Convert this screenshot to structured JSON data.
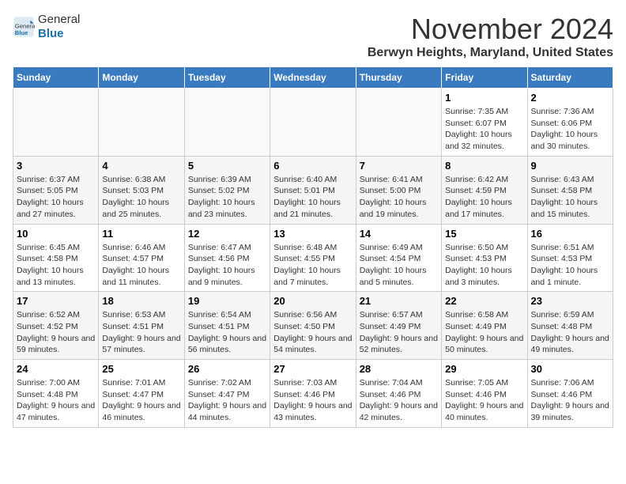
{
  "header": {
    "logo_line1": "General",
    "logo_line2": "Blue",
    "month_title": "November 2024",
    "location": "Berwyn Heights, Maryland, United States"
  },
  "calendar": {
    "days_of_week": [
      "Sunday",
      "Monday",
      "Tuesday",
      "Wednesday",
      "Thursday",
      "Friday",
      "Saturday"
    ],
    "weeks": [
      [
        {
          "day": "",
          "info": ""
        },
        {
          "day": "",
          "info": ""
        },
        {
          "day": "",
          "info": ""
        },
        {
          "day": "",
          "info": ""
        },
        {
          "day": "",
          "info": ""
        },
        {
          "day": "1",
          "info": "Sunrise: 7:35 AM\nSunset: 6:07 PM\nDaylight: 10 hours and 32 minutes."
        },
        {
          "day": "2",
          "info": "Sunrise: 7:36 AM\nSunset: 6:06 PM\nDaylight: 10 hours and 30 minutes."
        }
      ],
      [
        {
          "day": "3",
          "info": "Sunrise: 6:37 AM\nSunset: 5:05 PM\nDaylight: 10 hours and 27 minutes."
        },
        {
          "day": "4",
          "info": "Sunrise: 6:38 AM\nSunset: 5:03 PM\nDaylight: 10 hours and 25 minutes."
        },
        {
          "day": "5",
          "info": "Sunrise: 6:39 AM\nSunset: 5:02 PM\nDaylight: 10 hours and 23 minutes."
        },
        {
          "day": "6",
          "info": "Sunrise: 6:40 AM\nSunset: 5:01 PM\nDaylight: 10 hours and 21 minutes."
        },
        {
          "day": "7",
          "info": "Sunrise: 6:41 AM\nSunset: 5:00 PM\nDaylight: 10 hours and 19 minutes."
        },
        {
          "day": "8",
          "info": "Sunrise: 6:42 AM\nSunset: 4:59 PM\nDaylight: 10 hours and 17 minutes."
        },
        {
          "day": "9",
          "info": "Sunrise: 6:43 AM\nSunset: 4:58 PM\nDaylight: 10 hours and 15 minutes."
        }
      ],
      [
        {
          "day": "10",
          "info": "Sunrise: 6:45 AM\nSunset: 4:58 PM\nDaylight: 10 hours and 13 minutes."
        },
        {
          "day": "11",
          "info": "Sunrise: 6:46 AM\nSunset: 4:57 PM\nDaylight: 10 hours and 11 minutes."
        },
        {
          "day": "12",
          "info": "Sunrise: 6:47 AM\nSunset: 4:56 PM\nDaylight: 10 hours and 9 minutes."
        },
        {
          "day": "13",
          "info": "Sunrise: 6:48 AM\nSunset: 4:55 PM\nDaylight: 10 hours and 7 minutes."
        },
        {
          "day": "14",
          "info": "Sunrise: 6:49 AM\nSunset: 4:54 PM\nDaylight: 10 hours and 5 minutes."
        },
        {
          "day": "15",
          "info": "Sunrise: 6:50 AM\nSunset: 4:53 PM\nDaylight: 10 hours and 3 minutes."
        },
        {
          "day": "16",
          "info": "Sunrise: 6:51 AM\nSunset: 4:53 PM\nDaylight: 10 hours and 1 minute."
        }
      ],
      [
        {
          "day": "17",
          "info": "Sunrise: 6:52 AM\nSunset: 4:52 PM\nDaylight: 9 hours and 59 minutes."
        },
        {
          "day": "18",
          "info": "Sunrise: 6:53 AM\nSunset: 4:51 PM\nDaylight: 9 hours and 57 minutes."
        },
        {
          "day": "19",
          "info": "Sunrise: 6:54 AM\nSunset: 4:51 PM\nDaylight: 9 hours and 56 minutes."
        },
        {
          "day": "20",
          "info": "Sunrise: 6:56 AM\nSunset: 4:50 PM\nDaylight: 9 hours and 54 minutes."
        },
        {
          "day": "21",
          "info": "Sunrise: 6:57 AM\nSunset: 4:49 PM\nDaylight: 9 hours and 52 minutes."
        },
        {
          "day": "22",
          "info": "Sunrise: 6:58 AM\nSunset: 4:49 PM\nDaylight: 9 hours and 50 minutes."
        },
        {
          "day": "23",
          "info": "Sunrise: 6:59 AM\nSunset: 4:48 PM\nDaylight: 9 hours and 49 minutes."
        }
      ],
      [
        {
          "day": "24",
          "info": "Sunrise: 7:00 AM\nSunset: 4:48 PM\nDaylight: 9 hours and 47 minutes."
        },
        {
          "day": "25",
          "info": "Sunrise: 7:01 AM\nSunset: 4:47 PM\nDaylight: 9 hours and 46 minutes."
        },
        {
          "day": "26",
          "info": "Sunrise: 7:02 AM\nSunset: 4:47 PM\nDaylight: 9 hours and 44 minutes."
        },
        {
          "day": "27",
          "info": "Sunrise: 7:03 AM\nSunset: 4:46 PM\nDaylight: 9 hours and 43 minutes."
        },
        {
          "day": "28",
          "info": "Sunrise: 7:04 AM\nSunset: 4:46 PM\nDaylight: 9 hours and 42 minutes."
        },
        {
          "day": "29",
          "info": "Sunrise: 7:05 AM\nSunset: 4:46 PM\nDaylight: 9 hours and 40 minutes."
        },
        {
          "day": "30",
          "info": "Sunrise: 7:06 AM\nSunset: 4:46 PM\nDaylight: 9 hours and 39 minutes."
        }
      ]
    ]
  }
}
